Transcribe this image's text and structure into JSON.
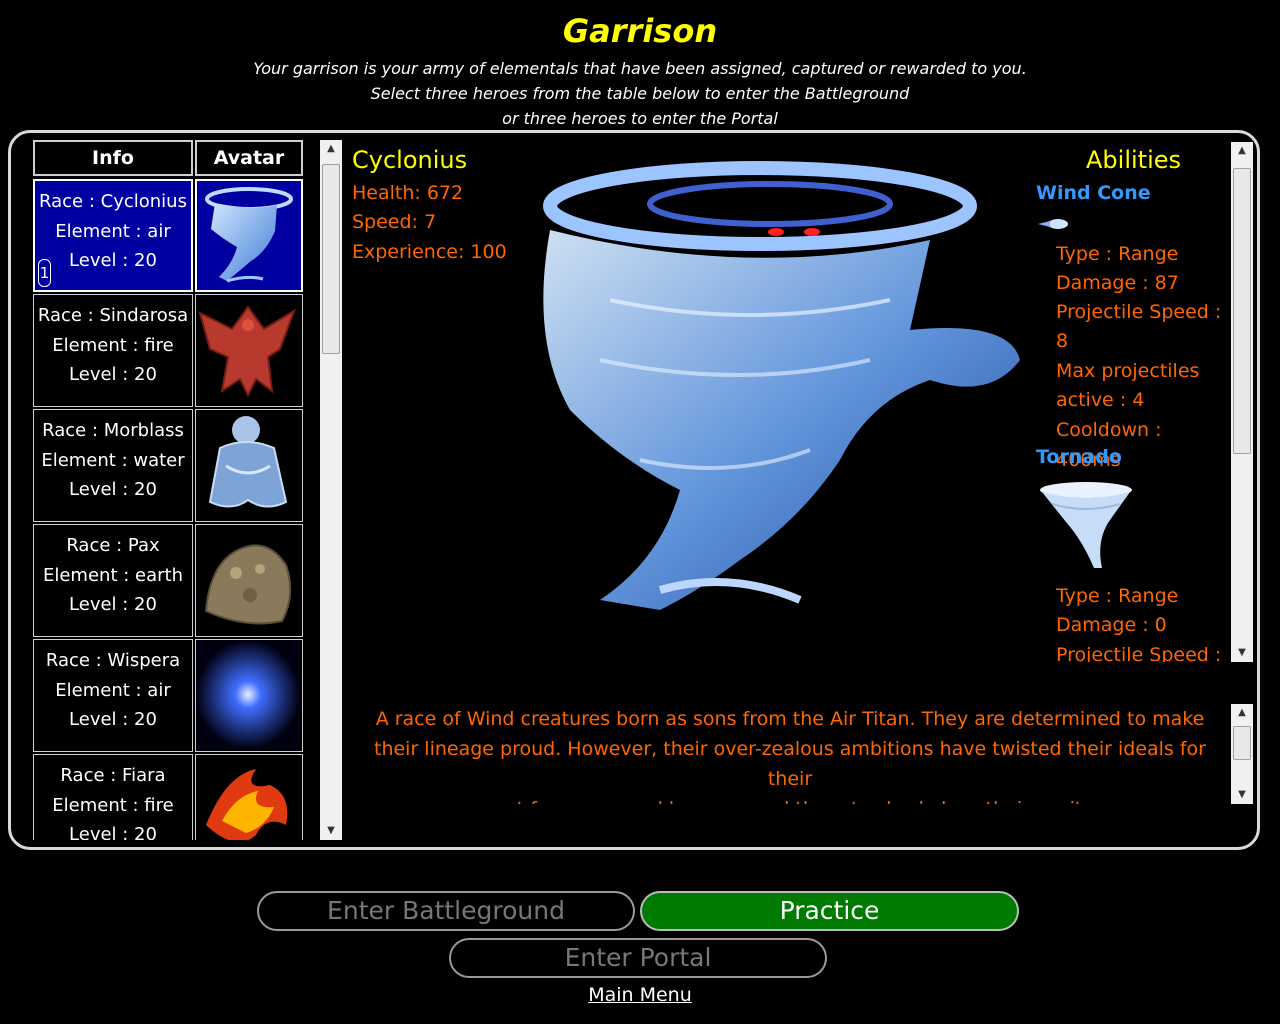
{
  "page": {
    "title": "Garrison",
    "subtitle_lines": [
      "Your garrison is your army of elementals that have been assigned, captured or rewarded to you.",
      "Select three heroes from the table below to enter the Battleground",
      "or three heroes to enter the Portal"
    ]
  },
  "table": {
    "headers": {
      "info": "Info",
      "avatar": "Avatar"
    },
    "rows": [
      {
        "race": "Race : Cyclonius",
        "element": "Element : air",
        "level": "Level : 20",
        "badge": "1",
        "selected": true,
        "avatar_icon": "cyclonius-avatar-icon"
      },
      {
        "race": "Race : Sindarosa",
        "element": "Element : fire",
        "level": "Level : 20",
        "avatar_icon": "sindarosa-avatar-icon"
      },
      {
        "race": "Race : Morblass",
        "element": "Element : water",
        "level": "Level : 20",
        "avatar_icon": "morblass-avatar-icon"
      },
      {
        "race": "Race : Pax",
        "element": "Element : earth",
        "level": "Level : 20",
        "avatar_icon": "pax-avatar-icon"
      },
      {
        "race": "Race : Wispera",
        "element": "Element : air",
        "level": "Level : 20",
        "avatar_icon": "wispera-avatar-icon"
      },
      {
        "race": "Race : Fiara",
        "element": "Element : fire",
        "level": "Level : 20",
        "avatar_icon": "fiara-avatar-icon"
      }
    ]
  },
  "detail": {
    "name": "Cyclonius",
    "health": "Health: 672",
    "speed": "Speed: 7",
    "experience": "Experience: 100",
    "abilities_title": "Abilities",
    "abilities": [
      {
        "name": "Wind Cone",
        "lines": [
          "Type : Range",
          "Damage : 87",
          "Projectile Speed :",
          "8",
          "Max projectiles",
          "active : 4",
          "Cooldown : 400ms"
        ]
      },
      {
        "name": "Tornado",
        "lines": [
          "Type : Range",
          "Damage : 0",
          "Projectile Speed :"
        ]
      }
    ],
    "description_lines": [
      "A race of Wind creatures born as sons from the Air Titan. They are determined to make",
      "their lineage proud. However, their over-zealous ambitions have twisted their ideals for their",
      "quest for power and have caused them to slowly lose their sanity..."
    ]
  },
  "buttons": {
    "battleground": "Enter Battleground",
    "practice": "Practice",
    "portal": "Enter Portal",
    "main_menu": "Main Menu"
  },
  "colors": {
    "title": "#ffff00",
    "stat_text": "#ff6600",
    "ability_name": "#3399ff",
    "selected_row": "#0000a0",
    "practice_button": "#007a00"
  }
}
